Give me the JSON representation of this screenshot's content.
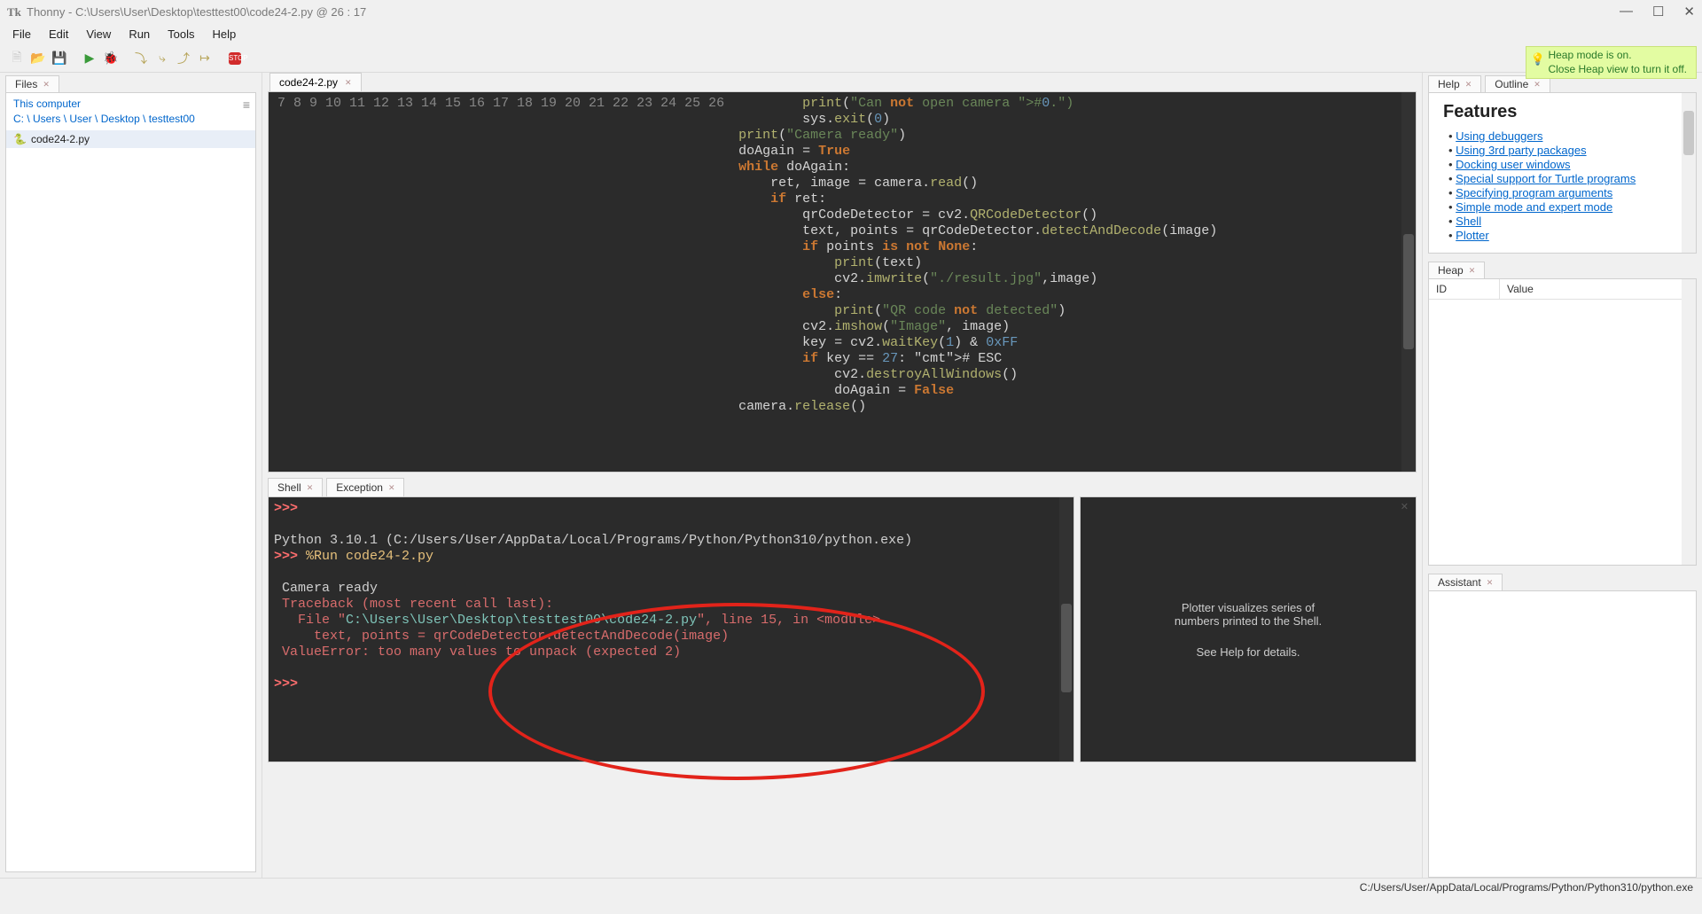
{
  "title": {
    "app": "Thonny",
    "sep": "  -  ",
    "path": "C:\\Users\\User\\Desktop\\testtest00\\code24-2.py",
    "cursor": "  @  26 : 17"
  },
  "menu": [
    "File",
    "Edit",
    "View",
    "Run",
    "Tools",
    "Help"
  ],
  "heap_notice": {
    "line1": "Heap mode is on.",
    "line2": "Close Heap view to turn it off."
  },
  "files": {
    "tab": "Files",
    "root": "This computer",
    "crumbs": [
      "C:",
      "Users",
      "User",
      "Desktop",
      "testtest00"
    ],
    "item": "code24-2.py"
  },
  "editor": {
    "tab": "code24-2.py",
    "lines_start": 7,
    "lines_end": 26
  },
  "code": {
    "l7": "        print(\"Can not open camera #0.\")",
    "l8": "        sys.exit(0)",
    "l9": "print(\"Camera ready\")",
    "l10": "doAgain = True",
    "l11": "while doAgain:",
    "l12": "    ret, image = camera.read()",
    "l13": "    if ret:",
    "l14": "        qrCodeDetector = cv2.QRCodeDetector()",
    "l15": "        text, points = qrCodeDetector.detectAndDecode(image)",
    "l16": "        if points is not None:",
    "l17": "            print(text)",
    "l18": "            cv2.imwrite(\"./result.jpg\",image)",
    "l19": "        else:",
    "l20": "            print(\"QR code not detected\")",
    "l21": "        cv2.imshow(\"Image\", image)",
    "l22": "        key = cv2.waitKey(1) & 0xFF",
    "l23": "        if key == 27: # ESC",
    "l24": "            cv2.destroyAllWindows()",
    "l25": "            doAgain = False",
    "l26": "camera.release()"
  },
  "shell": {
    "tab1": "Shell",
    "tab2": "Exception",
    "prompt": ">>>",
    "banner": "Python 3.10.1 (C:/Users/User/AppData/Local/Programs/Python/Python310/python.exe)",
    "run": "%Run code24-2.py",
    "out1": "Camera ready",
    "trace1": "Traceback (most recent call last):",
    "trace2a": "  File \"",
    "trace2b": "C:\\Users\\User\\Desktop\\testtest00\\code24-2.py",
    "trace2c": "\", line 15, in <module>",
    "trace3": "    text, points = qrCodeDetector.detectAndDecode(image)",
    "err": "ValueError: too many values to unpack (expected 2)"
  },
  "plotter": {
    "line1": "Plotter visualizes series of",
    "line2": "numbers printed to the Shell.",
    "line3": "See Help for details."
  },
  "help": {
    "tab1": "Help",
    "tab2": "Outline",
    "heading": "Features",
    "links": [
      "Using debuggers",
      "Using 3rd party packages",
      "Docking user windows",
      "Special support for Turtle programs",
      "Specifying program arguments",
      "Simple mode and expert mode",
      "Shell",
      "Plotter"
    ]
  },
  "heap": {
    "tab": "Heap",
    "col1": "ID",
    "col2": "Value"
  },
  "assistant": {
    "tab": "Assistant"
  },
  "status": "C:/Users/User/AppData/Local/Programs/Python/Python310/python.exe"
}
